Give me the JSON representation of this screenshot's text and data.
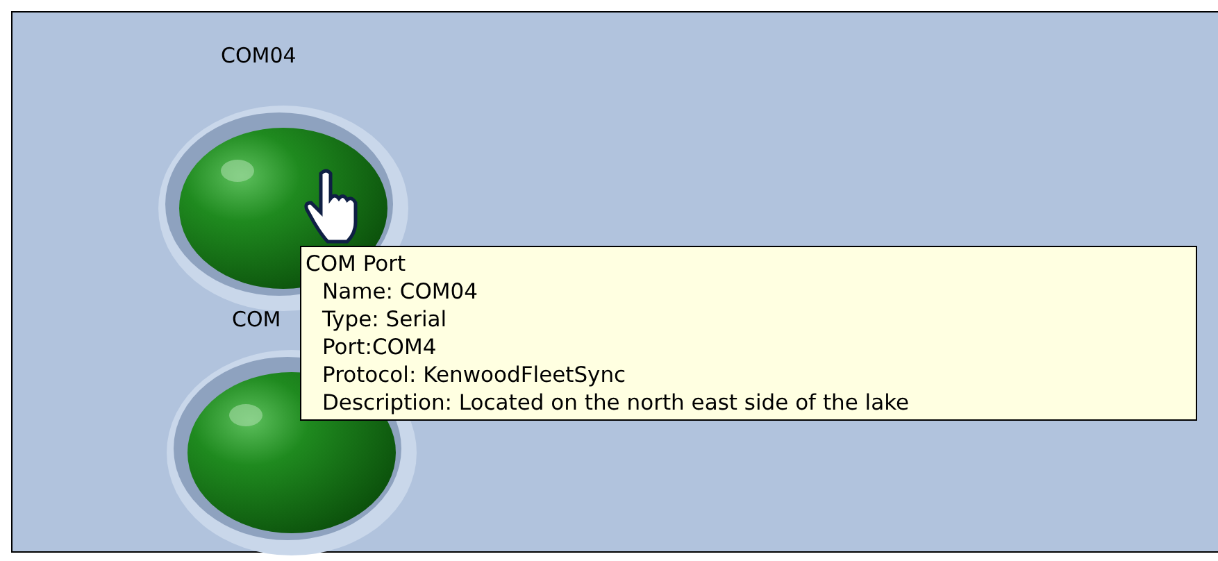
{
  "nodes": [
    {
      "label": "COM04"
    },
    {
      "label": "COM"
    }
  ],
  "tooltip": {
    "title": "COM Port",
    "lines": [
      "Name: COM04",
      "Type: Serial",
      "Port:COM4",
      "Protocol: KenwoodFleetSync",
      "Description: Located on the north east side of the lake"
    ]
  }
}
